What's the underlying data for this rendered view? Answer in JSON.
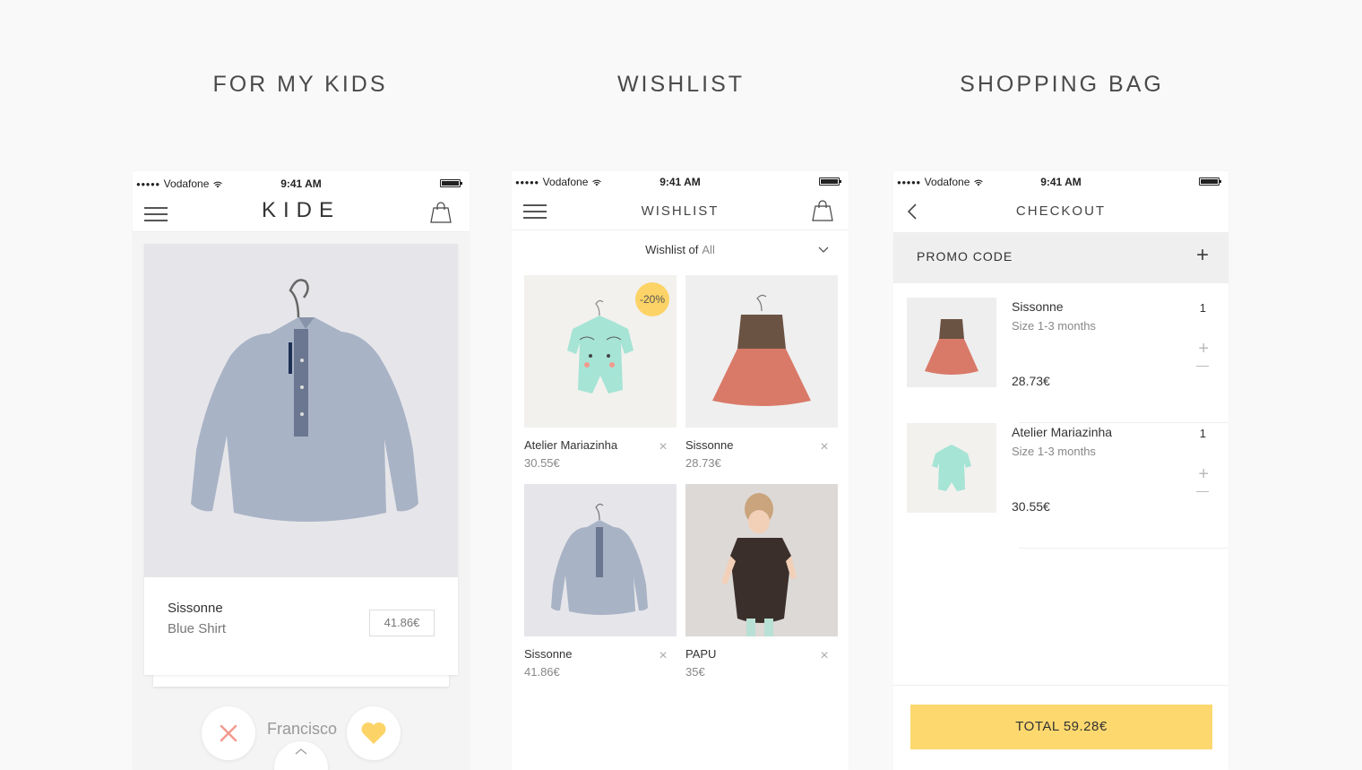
{
  "sections": {
    "kids": "FOR MY KIDS",
    "wishlist": "WISHLIST",
    "bag": "SHOPPING BAG"
  },
  "status": {
    "carrier": "Vodafone",
    "time": "9:41 AM"
  },
  "kids_screen": {
    "logo": "KIDE",
    "product": {
      "brand": "Sissonne",
      "name": "Blue Shirt",
      "price": "41.86€"
    },
    "kid_name": "Francisco",
    "icons": [
      "menu-icon",
      "shopping-bag-icon",
      "close-icon",
      "heart-icon",
      "chevron-up-icon"
    ]
  },
  "wishlist_screen": {
    "title": "WISHLIST",
    "filter_label": "Wishlist of",
    "filter_value": "All",
    "items": [
      {
        "brand": "Atelier Mariazinha",
        "price": "30.55€",
        "badge": "-20%"
      },
      {
        "brand": "Sissonne",
        "price": "28.73€"
      },
      {
        "brand": "Sissonne",
        "price": "41.86€"
      },
      {
        "brand": "PAPU",
        "price": "35€"
      }
    ]
  },
  "checkout_screen": {
    "title": "CHECKOUT",
    "promo_label": "PROMO CODE",
    "items": [
      {
        "brand": "Sissonne",
        "size": "Size 1-3 months",
        "price": "28.73€",
        "qty": "1"
      },
      {
        "brand": "Atelier Mariazinha",
        "size": "Size 1-3 months",
        "price": "30.55€",
        "qty": "1"
      }
    ],
    "total": "TOTAL 59.28€"
  },
  "colors": {
    "accent_yellow": "#fcd86e",
    "reject_red": "#f29a8e",
    "heart_yellow": "#fcd366"
  }
}
